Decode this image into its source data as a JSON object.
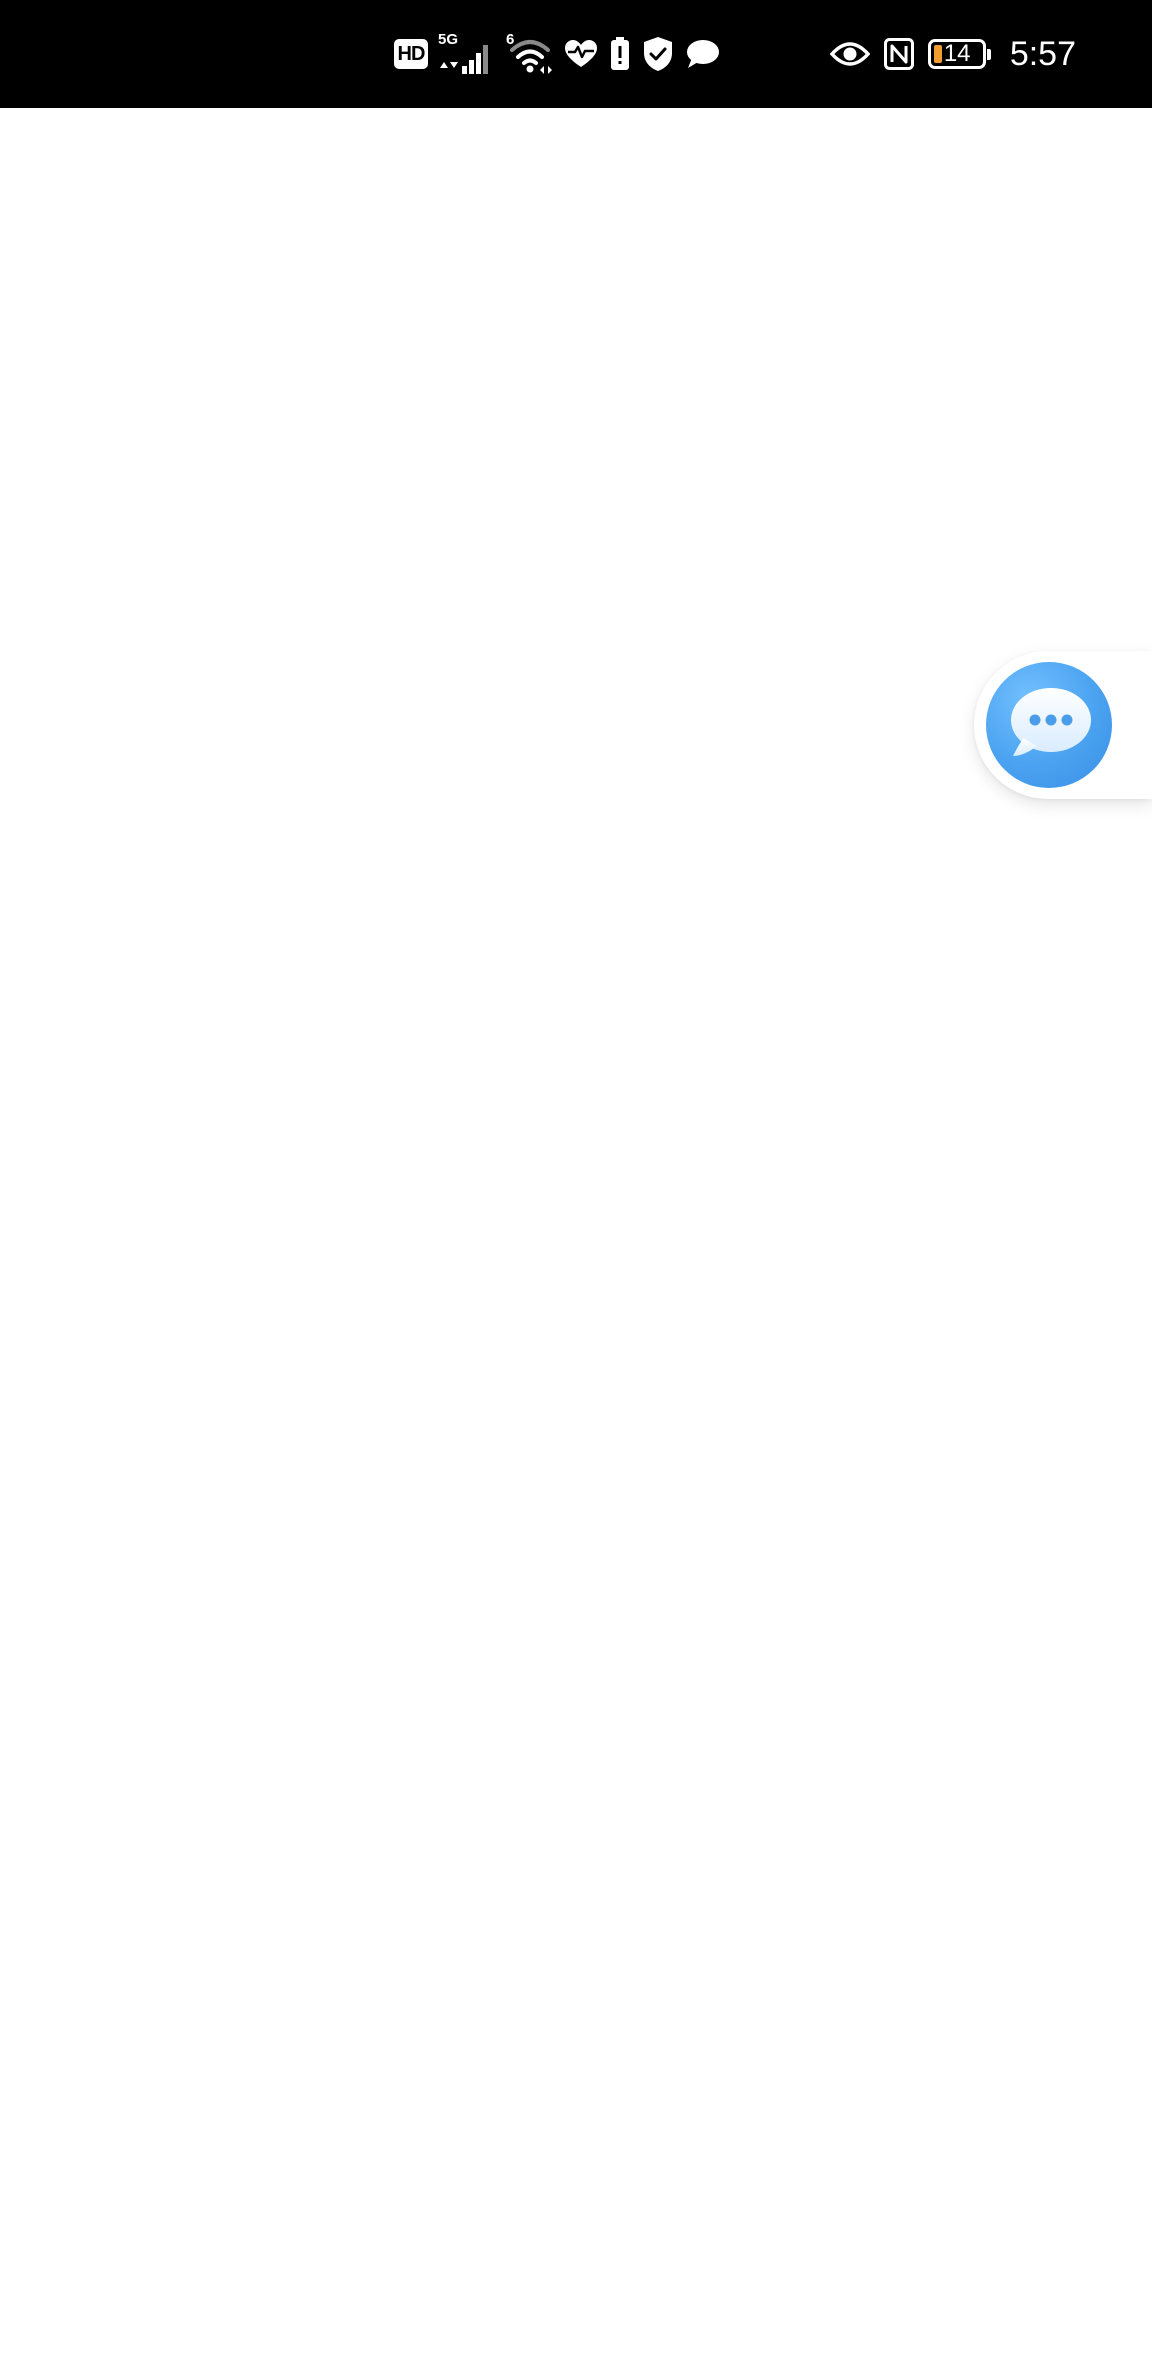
{
  "status_bar": {
    "hd_label": "HD",
    "network_label": "5G",
    "wifi_label": "6",
    "battery_level": "14",
    "time": "5:57",
    "icons": [
      "hd-icon",
      "cellular-signal-icon",
      "wifi-icon",
      "health-heart-icon",
      "battery-alert-icon",
      "shield-check-icon",
      "chat-bubble-icon",
      "eye-icon",
      "nfc-icon",
      "battery-icon"
    ]
  },
  "floating_assistant": {
    "icon": "chat-bubble-icon",
    "accent_color": "#4aa2f0"
  },
  "colors": {
    "status_bar_background": "#000000",
    "page_background": "#ffffff",
    "battery_fill": "#f29e2e"
  }
}
